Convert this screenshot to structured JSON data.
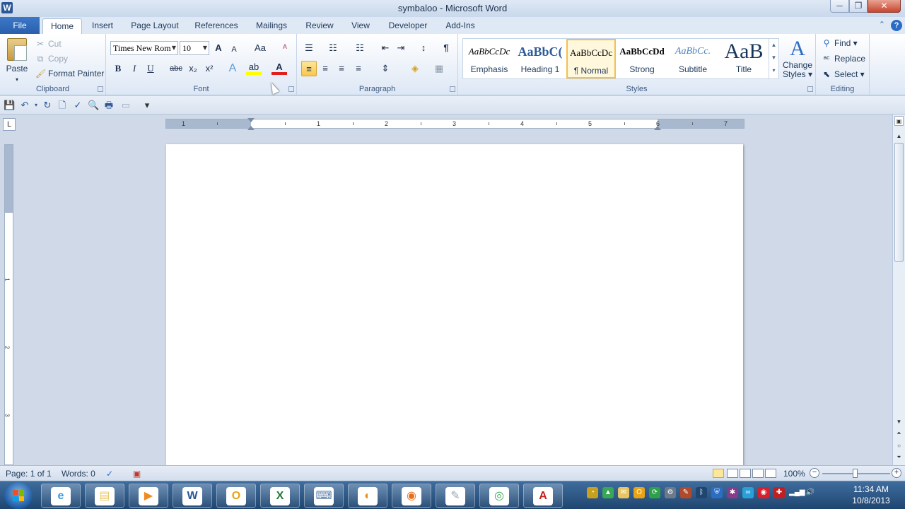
{
  "window": {
    "app_icon": "W",
    "title": "symbaloo  -  Microsoft Word",
    "min": "─",
    "max": "❐",
    "close": "✕"
  },
  "tabs": {
    "file": "File",
    "items": [
      "Home",
      "Insert",
      "Page Layout",
      "References",
      "Mailings",
      "Review",
      "View",
      "Developer",
      "Add-Ins"
    ],
    "active": "Home",
    "collapse_icon": "⌃",
    "help_icon": "?"
  },
  "clipboard": {
    "label": "Clipboard",
    "paste": "Paste",
    "cut": "Cut",
    "copy": "Copy",
    "format_painter": "Format Painter"
  },
  "font": {
    "label": "Font",
    "font_name": "Times New Rom",
    "font_size": "10",
    "grow": "A",
    "shrink": "A",
    "change_case": "Aa",
    "clear": "ᴬ",
    "bold": "B",
    "italic": "I",
    "underline": "U",
    "strike": "abc",
    "subscript": "x₂",
    "superscript": "x²",
    "effects": "A",
    "highlight": "ab",
    "font_color": "A"
  },
  "paragraph": {
    "label": "Paragraph",
    "bullets": "☰",
    "numbering": "☷",
    "multilevel": "☷",
    "decrease_indent": "⇤",
    "increase_indent": "⇥",
    "sort": "↕",
    "show_marks": "¶",
    "align_left": "≡",
    "center": "≡",
    "align_right": "≡",
    "justify": "≡",
    "line_spacing": "⇕",
    "shading": "◈",
    "borders": "▦"
  },
  "styles": {
    "label": "Styles",
    "items": [
      {
        "preview": "AaBbCcDc",
        "name": "Emphasis"
      },
      {
        "preview": "AaBbC(",
        "name": "Heading 1"
      },
      {
        "preview": "AaBbCcDc",
        "name": "¶ Normal"
      },
      {
        "preview": "AaBbCcDd",
        "name": "Strong"
      },
      {
        "preview": "AaBbCc.",
        "name": "Subtitle"
      },
      {
        "preview": "AaB",
        "name": "Title"
      }
    ],
    "selected": "¶ Normal",
    "change_styles_line1": "Change",
    "change_styles_line2": "Styles ▾",
    "change_icon": "A"
  },
  "editing": {
    "label": "Editing",
    "find": "Find ▾",
    "replace": "Replace",
    "select": "Select ▾"
  },
  "qat": {
    "save": "💾",
    "undo": "↶",
    "redo": "↻",
    "new": "🗋",
    "spelling": "✓",
    "preview": "🔍",
    "print": "🖶",
    "blank": "▭",
    "customize": "▾"
  },
  "ruler": {
    "tab_selector": "L",
    "numbers": [
      "1",
      "1",
      "2",
      "3",
      "4",
      "5",
      "6",
      "7"
    ],
    "vnumbers": [
      "1",
      "2",
      "3"
    ]
  },
  "statusbar": {
    "page": "Page: 1 of 1",
    "words": "Words: 0",
    "zoom": "100%",
    "zoom_minus": "−",
    "zoom_plus": "+"
  },
  "taskbar": {
    "apps": [
      {
        "name": "ie",
        "glyph": "e",
        "color": "#3a9ae0"
      },
      {
        "name": "explorer",
        "glyph": "▤",
        "color": "#e8c562"
      },
      {
        "name": "media",
        "glyph": "▶",
        "color": "#f08a24"
      },
      {
        "name": "word",
        "glyph": "W",
        "color": "#2b5797"
      },
      {
        "name": "outlook",
        "glyph": "O",
        "color": "#e8a317"
      },
      {
        "name": "excel",
        "glyph": "X",
        "color": "#1f7a3a"
      },
      {
        "name": "keyboard",
        "glyph": "⌨",
        "color": "#5a7ea8"
      },
      {
        "name": "app-orange",
        "glyph": "◐",
        "color": "#f08a24"
      },
      {
        "name": "firefox",
        "glyph": "◉",
        "color": "#e76f1c"
      },
      {
        "name": "tools",
        "glyph": "✎",
        "color": "#9aa7b8"
      },
      {
        "name": "chrome",
        "glyph": "◎",
        "color": "#3aa757"
      },
      {
        "name": "acrobat",
        "glyph": "A",
        "color": "#c4211b"
      }
    ],
    "time": "11:34 AM",
    "date": "10/8/2013"
  }
}
